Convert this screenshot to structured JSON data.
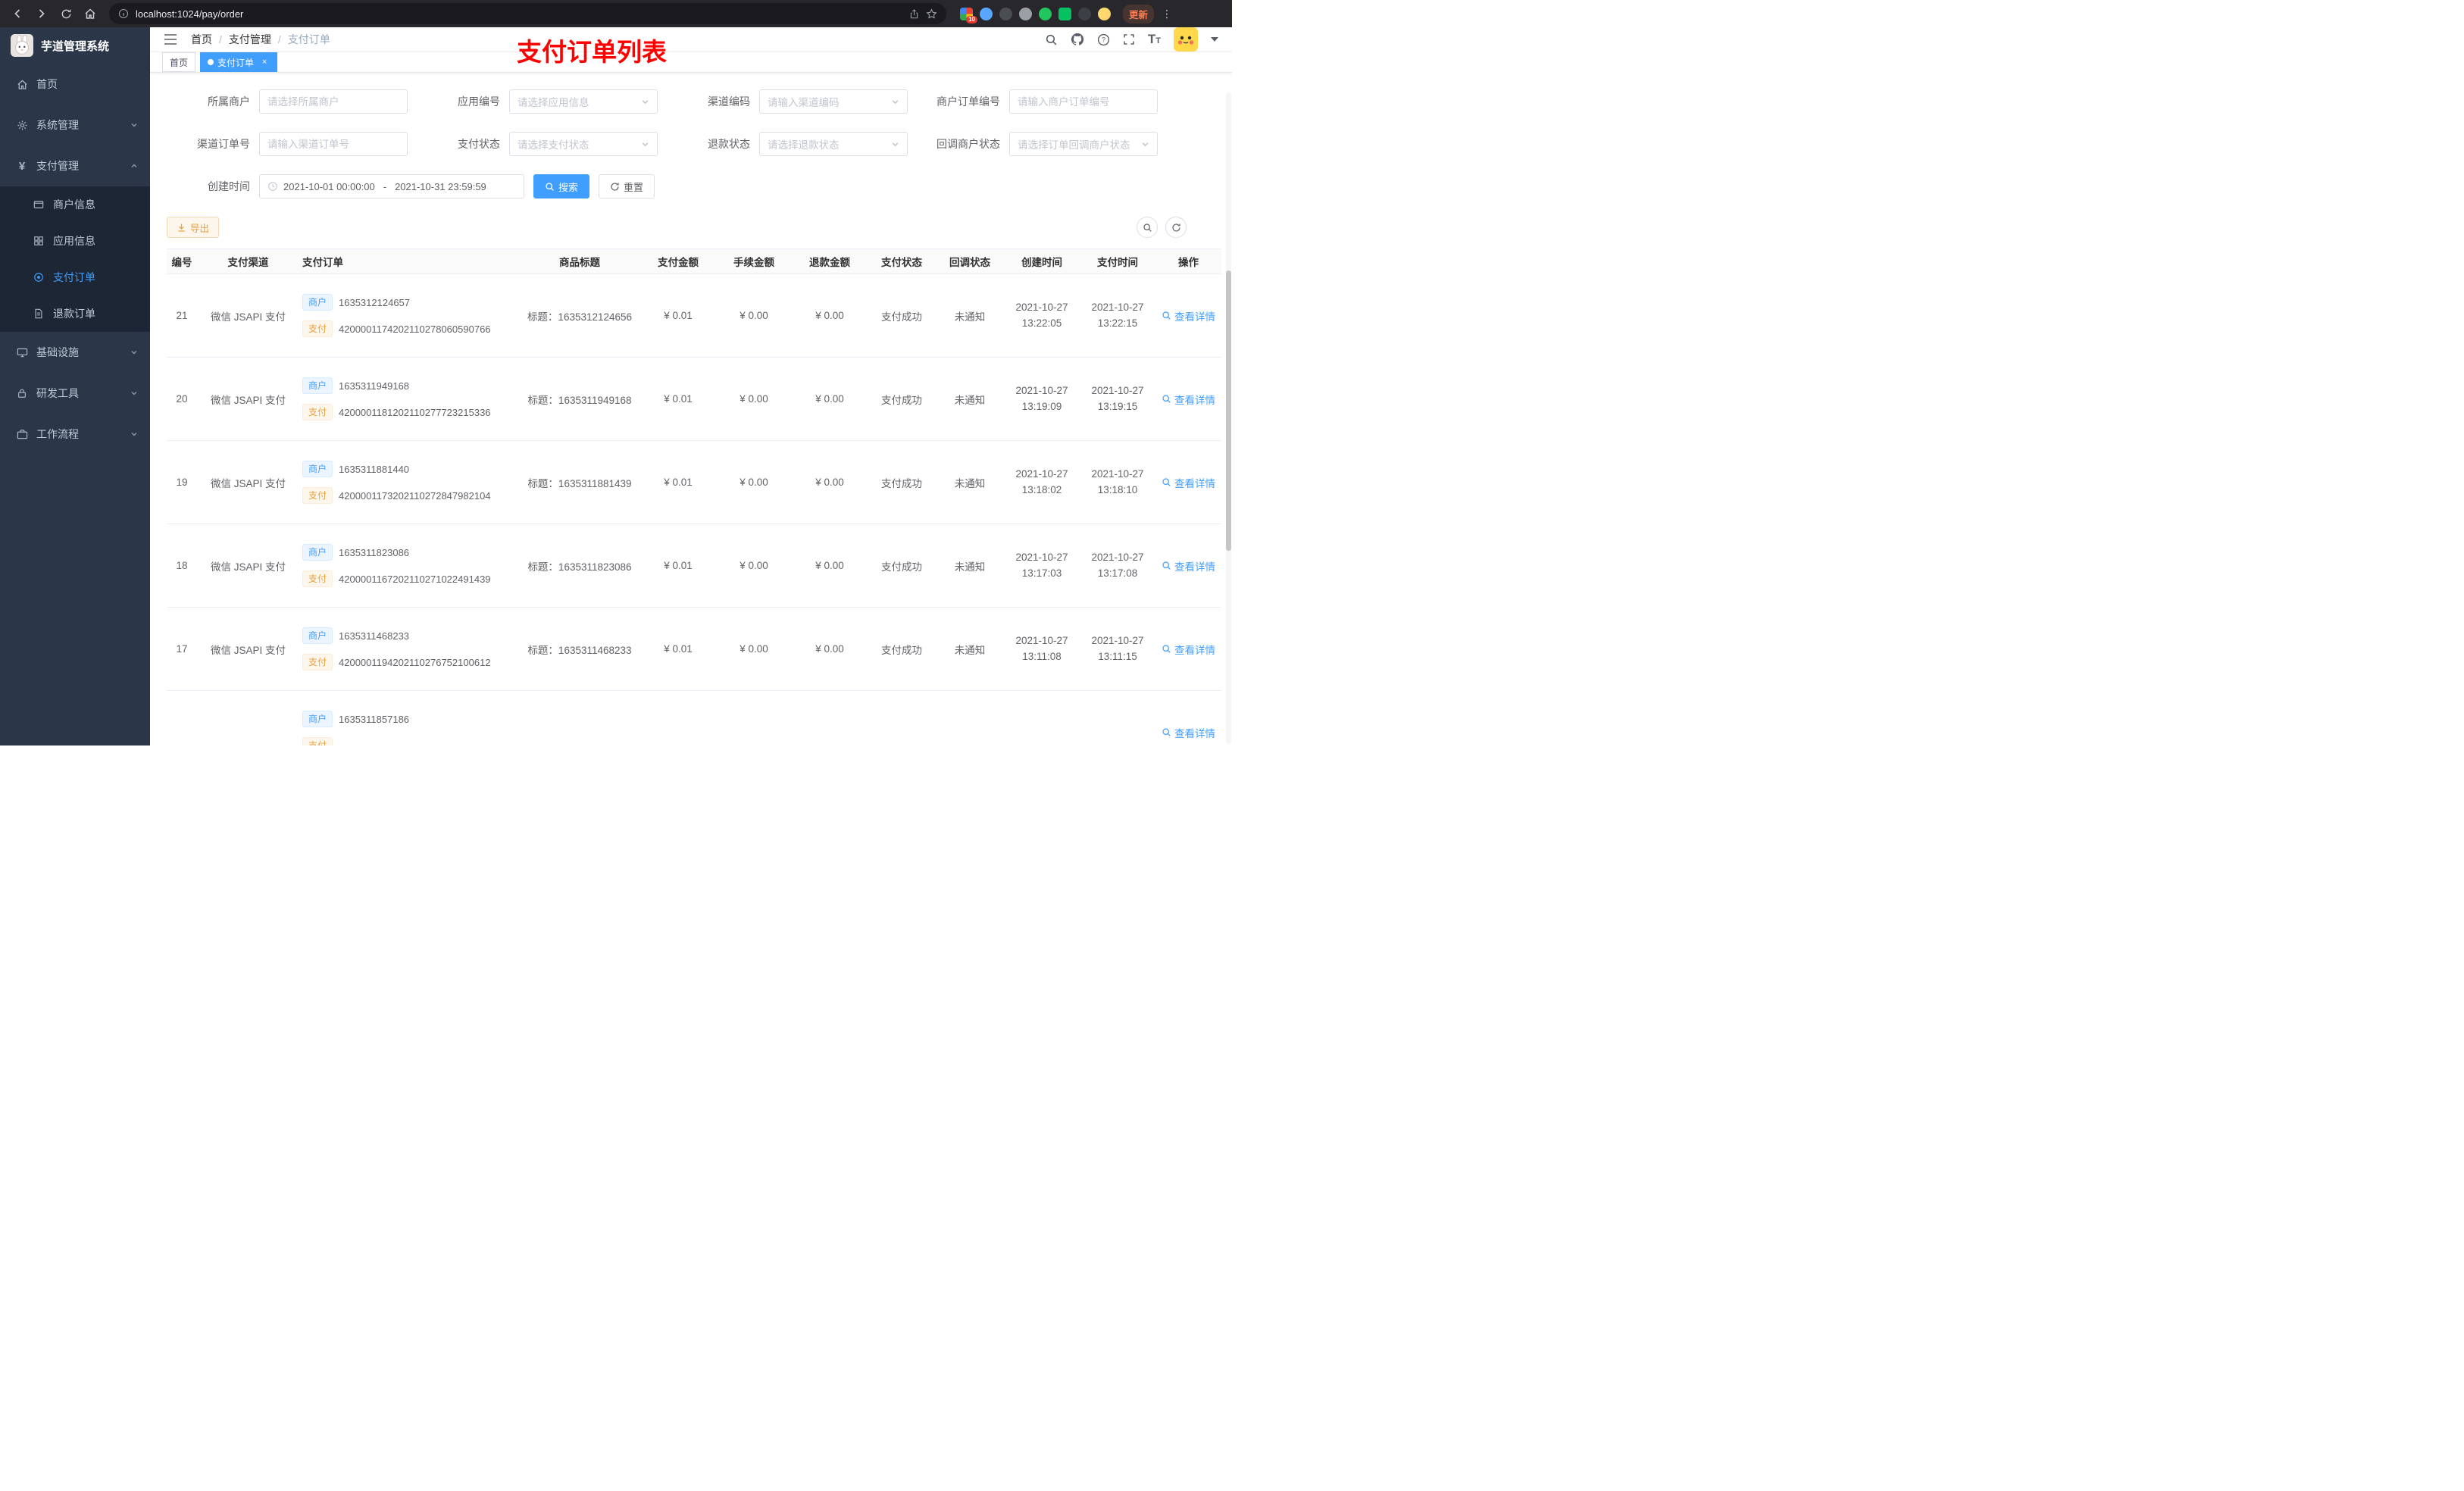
{
  "browser": {
    "url": "localhost:1024/pay/order",
    "extension_badge": "10",
    "update_button": "更新"
  },
  "sidebar": {
    "logo_title": "芋道管理系统",
    "menu": [
      {
        "label": "首页"
      },
      {
        "label": "系统管理"
      },
      {
        "label": "支付管理"
      },
      {
        "label": "基础设施"
      },
      {
        "label": "研发工具"
      },
      {
        "label": "工作流程"
      }
    ],
    "pay_submenu": [
      {
        "label": "商户信息"
      },
      {
        "label": "应用信息"
      },
      {
        "label": "支付订单"
      },
      {
        "label": "退款订单"
      }
    ]
  },
  "navbar": {
    "breadcrumb": [
      "首页",
      "支付管理",
      "支付订单"
    ],
    "separator": "/",
    "annotation": "支付订单列表"
  },
  "tags_view": {
    "tabs": [
      {
        "label": "首页"
      },
      {
        "label": "支付订单"
      }
    ],
    "close": "×"
  },
  "filters": {
    "fields": [
      {
        "label": "所属商户",
        "placeholder": "请选择所属商户"
      },
      {
        "label": "应用编号",
        "placeholder": "请选择应用信息"
      },
      {
        "label": "渠道编码",
        "placeholder": "请输入渠道编码"
      },
      {
        "label": "商户订单编号",
        "placeholder": "请输入商户订单编号"
      },
      {
        "label": "渠道订单号",
        "placeholder": "请输入渠道订单号"
      },
      {
        "label": "支付状态",
        "placeholder": "请选择支付状态"
      },
      {
        "label": "退款状态",
        "placeholder": "请选择退款状态"
      },
      {
        "label": "回调商户状态",
        "placeholder": "请选择订单回调商户状态"
      }
    ],
    "date_label": "创建时间",
    "date_start": "2021-10-01 00:00:00",
    "date_separator": "-",
    "date_end": "2021-10-31 23:59:59",
    "search_button": "搜索",
    "reset_button": "重置"
  },
  "toolbar": {
    "export_button": "导出"
  },
  "table": {
    "columns": [
      "编号",
      "支付渠道",
      "支付订单",
      "商品标题",
      "支付金额",
      "手续金额",
      "退款金额",
      "支付状态",
      "回调状态",
      "创建时间",
      "支付时间",
      "操作"
    ],
    "merchant_tag": "商户",
    "pay_tag": "支付",
    "action_label": "查看详情",
    "rows": [
      {
        "id": "21",
        "channel": "微信 JSAPI 支付",
        "merchant_no": "1635312124657",
        "channel_no": "4200001174202110278060590766",
        "title": "标题：1635312124656",
        "amount": "¥ 0.01",
        "fee": "¥ 0.00",
        "refund": "¥ 0.00",
        "status": "支付成功",
        "notify": "未通知",
        "create_date": "2021-10-27",
        "create_time": "13:22:05",
        "pay_date": "2021-10-27",
        "pay_time": "13:22:15"
      },
      {
        "id": "20",
        "channel": "微信 JSAPI 支付",
        "merchant_no": "1635311949168",
        "channel_no": "4200001181202110277723215336",
        "title": "标题：1635311949168",
        "amount": "¥ 0.01",
        "fee": "¥ 0.00",
        "refund": "¥ 0.00",
        "status": "支付成功",
        "notify": "未通知",
        "create_date": "2021-10-27",
        "create_time": "13:19:09",
        "pay_date": "2021-10-27",
        "pay_time": "13:19:15"
      },
      {
        "id": "19",
        "channel": "微信 JSAPI 支付",
        "merchant_no": "1635311881440",
        "channel_no": "4200001173202110272847982104",
        "title": "标题：1635311881439",
        "amount": "¥ 0.01",
        "fee": "¥ 0.00",
        "refund": "¥ 0.00",
        "status": "支付成功",
        "notify": "未通知",
        "create_date": "2021-10-27",
        "create_time": "13:18:02",
        "pay_date": "2021-10-27",
        "pay_time": "13:18:10"
      },
      {
        "id": "18",
        "channel": "微信 JSAPI 支付",
        "merchant_no": "1635311823086",
        "channel_no": "4200001167202110271022491439",
        "title": "标题：1635311823086",
        "amount": "¥ 0.01",
        "fee": "¥ 0.00",
        "refund": "¥ 0.00",
        "status": "支付成功",
        "notify": "未通知",
        "create_date": "2021-10-27",
        "create_time": "13:17:03",
        "pay_date": "2021-10-27",
        "pay_time": "13:17:08"
      },
      {
        "id": "17",
        "channel": "微信 JSAPI 支付",
        "merchant_no": "1635311468233",
        "channel_no": "4200001194202110276752100612",
        "title": "标题：1635311468233",
        "amount": "¥ 0.01",
        "fee": "¥ 0.00",
        "refund": "¥ 0.00",
        "status": "支付成功",
        "notify": "未通知",
        "create_date": "2021-10-27",
        "create_time": "13:11:08",
        "pay_date": "2021-10-27",
        "pay_time": "13:11:15"
      },
      {
        "id": "",
        "channel": "",
        "merchant_no": "1635311857186",
        "channel_no": "",
        "title": "",
        "amount": "",
        "fee": "",
        "refund": "",
        "status": "",
        "notify": "",
        "create_date": "",
        "create_time": "",
        "pay_date": "",
        "pay_time": "",
        "partial": true
      }
    ]
  }
}
